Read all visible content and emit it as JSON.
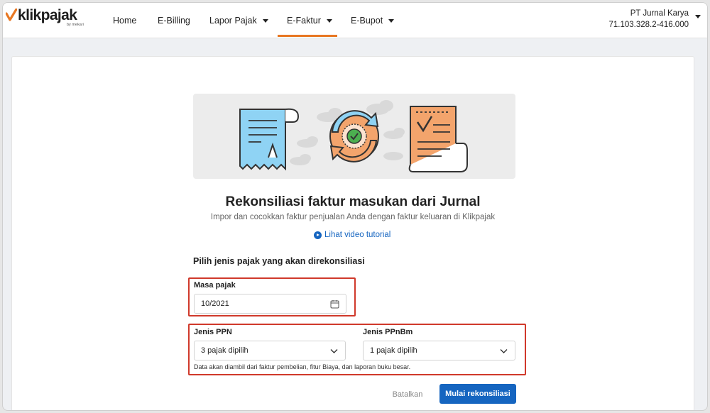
{
  "brand": {
    "logo_text": "klikpajak",
    "logo_sub": "by mekari",
    "accent": "#e87722"
  },
  "nav": {
    "items": [
      {
        "label": "Home"
      },
      {
        "label": "E-Billing"
      },
      {
        "label": "Lapor Pajak"
      },
      {
        "label": "E-Faktur"
      },
      {
        "label": "E-Bupot"
      }
    ],
    "active": "E-Faktur"
  },
  "company": {
    "name": "PT Jurnal Karya",
    "npwp": "71.103.328.2-416.000"
  },
  "main": {
    "title": "Rekonsiliasi faktur masukan dari Jurnal",
    "subtitle": "Impor dan cocokkan faktur penjualan Anda dengan faktur keluaran di Klikpajak",
    "video_link": "Lihat video tutorial",
    "section_heading": "Pilih jenis pajak yang akan direkonsiliasi",
    "masa_pajak": {
      "label": "Masa pajak",
      "value": "10/2021"
    },
    "jenis_ppn": {
      "label": "Jenis PPN",
      "value": "3 pajak dipilih"
    },
    "jenis_ppnbm": {
      "label": "Jenis PPnBm",
      "value": "1 pajak dipilih"
    },
    "helper_text": "Data akan diambil dari faktur pembelian, fitur Biaya, dan laporan buku besar.",
    "cancel_label": "Batalkan",
    "submit_label": "Mulai rekonsiliasi"
  },
  "colors": {
    "primary": "#1565c0",
    "highlight_border": "#d0392b"
  }
}
